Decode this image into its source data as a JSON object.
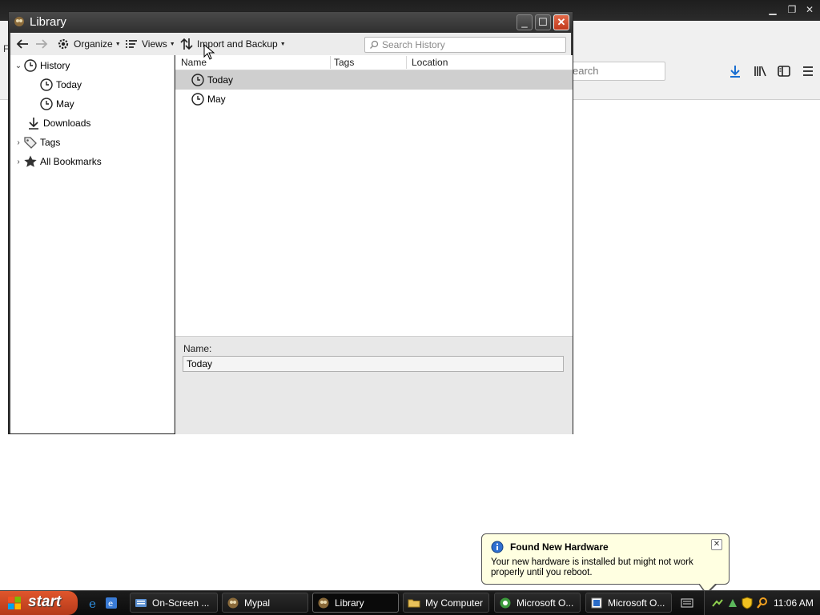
{
  "background_window": {
    "search_placeholder": "earch",
    "menu_stub": "F"
  },
  "library": {
    "title": "Library",
    "toolbar": {
      "organize": "Organize",
      "views": "Views",
      "import_backup": "Import and Backup",
      "search_placeholder": "Search History"
    },
    "sidebar": [
      {
        "label": "History",
        "icon": "clock-icon",
        "expanded": true
      },
      {
        "label": "Today",
        "icon": "clock-icon"
      },
      {
        "label": "May",
        "icon": "clock-icon"
      },
      {
        "label": "Downloads",
        "icon": "download-icon"
      },
      {
        "label": "Tags",
        "icon": "tag-icon",
        "expandable": true
      },
      {
        "label": "All Bookmarks",
        "icon": "star-icon",
        "expandable": true
      }
    ],
    "columns": [
      "Name",
      "Tags",
      "Location"
    ],
    "rows": [
      {
        "name": "Today",
        "icon": "clock-icon",
        "selected": true
      },
      {
        "name": "May",
        "icon": "clock-icon",
        "selected": false
      }
    ],
    "details": {
      "name_label": "Name:",
      "name_value": "Today"
    }
  },
  "balloon": {
    "title": "Found New Hardware",
    "text": "Your new hardware is installed but might not work properly until you reboot."
  },
  "taskbar": {
    "start_label": "start",
    "tasks": [
      {
        "label": "On-Screen ...",
        "icon": "keyboard-icon"
      },
      {
        "label": "Mypal",
        "icon": "mypal-icon"
      },
      {
        "label": "Library",
        "icon": "mypal-icon",
        "active": true
      },
      {
        "label": "My Computer",
        "icon": "folder-icon"
      },
      {
        "label": "Microsoft O...",
        "icon": "office-icon"
      },
      {
        "label": "Microsoft O...",
        "icon": "office-icon"
      }
    ],
    "clock": "11:06 AM"
  },
  "colors": {
    "taskbar": "#111111",
    "start_button": "#c9461f",
    "balloon_bg": "#ffffe1",
    "selected_row": "#cfcfcf"
  }
}
